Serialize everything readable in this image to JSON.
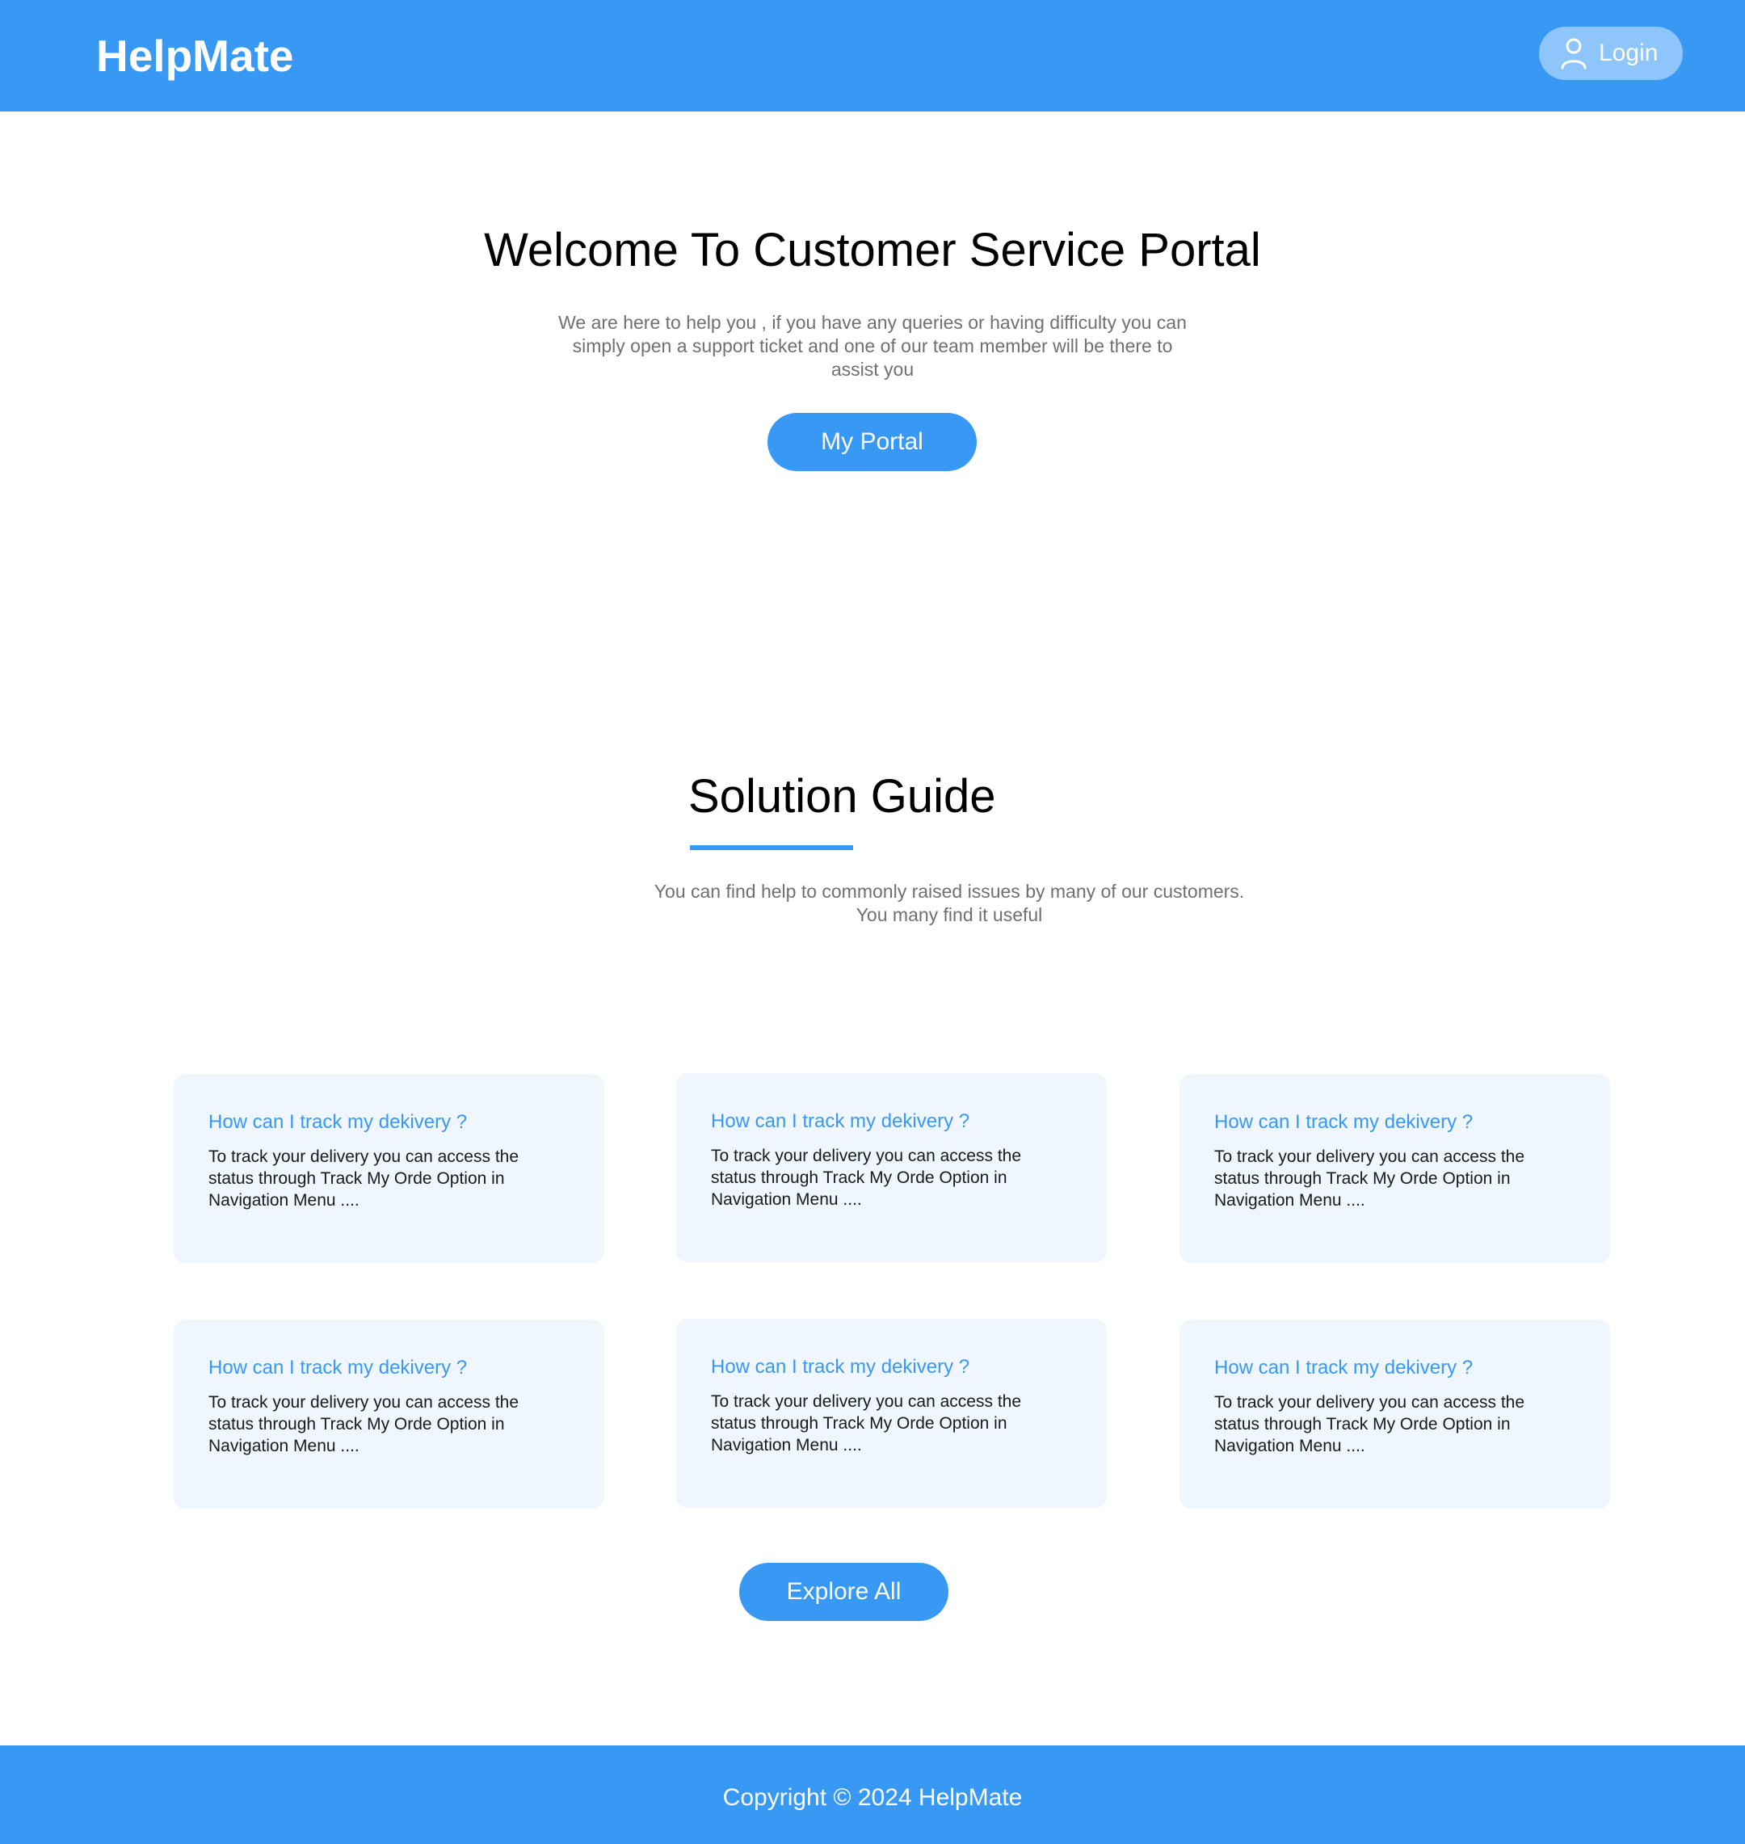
{
  "header": {
    "logo": "HelpMate",
    "login_label": "Login",
    "login_icon": "user-icon"
  },
  "hero": {
    "title": "Welcome To Customer Service Portal",
    "description": "We are here to help you  , if you have any queries or having difficulty you can simply open a support ticket and one of our team member will be there to assist you",
    "button_label": "My Portal"
  },
  "guide": {
    "title": "Solution Guide",
    "description": "You can find help to commonly raised issues by many of our customers. You many find it useful",
    "cards": [
      {
        "title": "How can I track my dekivery ?",
        "body": "To track your delivery you can access the status through Track My Orde Option in Navigation Menu ...."
      },
      {
        "title": "How can I track my dekivery ?",
        "body": "To track your delivery you can access the status through Track My Orde Option in Navigation Menu ...."
      },
      {
        "title": "How can I track my dekivery ?",
        "body": "To track your delivery you can access the status through Track My Orde Option in Navigation Menu ...."
      },
      {
        "title": "How can I track my dekivery ?",
        "body": "To track your delivery you can access the status through Track My Orde Option in Navigation Menu ...."
      },
      {
        "title": "How can I track my dekivery ?",
        "body": "To track your delivery you can access the status through Track My Orde Option in Navigation Menu ...."
      },
      {
        "title": "How can I track my dekivery ?",
        "body": "To track your delivery you can access the status through Track My Orde Option in Navigation Menu ...."
      }
    ],
    "explore_label": "Explore All"
  },
  "footer": {
    "copyright": "Copyright © 2024 HelpMate"
  },
  "colors": {
    "brand": "#3899F5",
    "login_button": "#8EC5FA",
    "card_background": "#EFF6FE",
    "muted_text": "#707070"
  }
}
